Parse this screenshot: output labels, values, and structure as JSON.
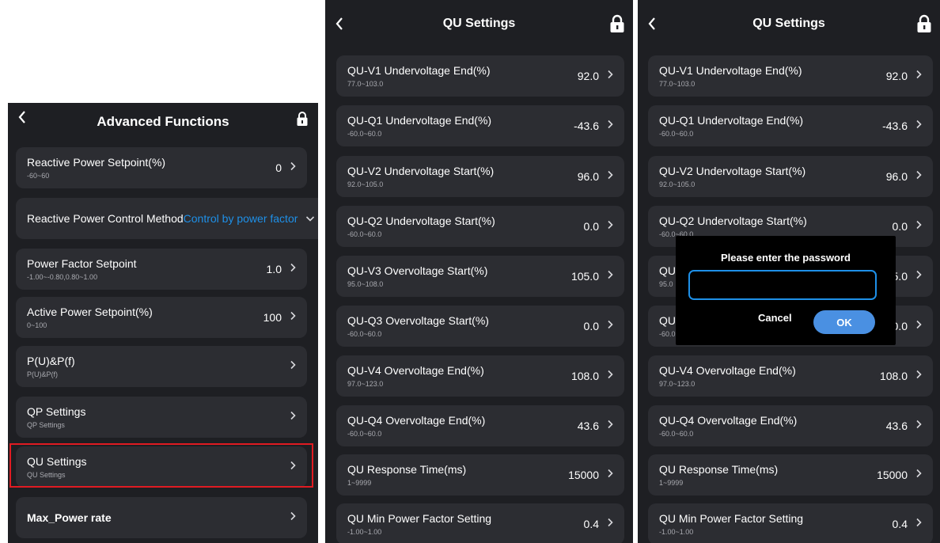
{
  "left": {
    "title": "Advanced Functions",
    "items": [
      {
        "label": "Reactive Power Setpoint(%)",
        "range": "-60~60",
        "value": "0"
      },
      {
        "label_main": "Reactive Power Control Method",
        "label_accent": "Control by power factor"
      },
      {
        "label": "Power Factor Setpoint",
        "range": "-1.00~-0.80,0.80~1.00",
        "value": "1.0"
      },
      {
        "label": "Active Power Setpoint(%)",
        "range": "0~100",
        "value": "100"
      },
      {
        "label": "P(U)&P(f)",
        "range": "P(U)&P(f)",
        "value": ""
      },
      {
        "label": "QP Settings",
        "range": "QP Settings",
        "value": ""
      },
      {
        "label": "QU Settings",
        "range": "QU Settings",
        "value": ""
      },
      {
        "label": "Max_Power rate",
        "range": "",
        "value": ""
      }
    ],
    "highlight_color": "#e01b22"
  },
  "middle": {
    "title": "QU Settings",
    "items": [
      {
        "label": "QU-V1 Undervoltage End(%)",
        "range": "77.0~103.0",
        "value": "92.0"
      },
      {
        "label": "QU-Q1 Undervoltage End(%)",
        "range": "-60.0~60.0",
        "value": "-43.6"
      },
      {
        "label": "QU-V2 Undervoltage Start(%)",
        "range": "92.0~105.0",
        "value": "96.0"
      },
      {
        "label": "QU-Q2 Undervoltage Start(%)",
        "range": "-60.0~60.0",
        "value": "0.0"
      },
      {
        "label": "QU-V3 Overvoltage Start(%)",
        "range": "95.0~108.0",
        "value": "105.0"
      },
      {
        "label": "QU-Q3 Overvoltage Start(%)",
        "range": "-60.0~60.0",
        "value": "0.0"
      },
      {
        "label": "QU-V4 Overvoltage End(%)",
        "range": "97.0~123.0",
        "value": "108.0"
      },
      {
        "label": "QU-Q4 Overvoltage End(%)",
        "range": "-60.0~60.0",
        "value": "43.6"
      },
      {
        "label": "QU Response Time(ms)",
        "range": "1~9999",
        "value": "15000"
      },
      {
        "label": "QU Min Power Factor Setting",
        "range": "-1.00~1.00",
        "value": "0.4"
      }
    ]
  },
  "right": {
    "title": "QU Settings",
    "items": [
      {
        "label": "QU-V1 Undervoltage End(%)",
        "range": "77.0~103.0",
        "value": "92.0"
      },
      {
        "label": "QU-Q1 Undervoltage End(%)",
        "range": "-60.0~60.0",
        "value": "-43.6"
      },
      {
        "label": "QU-V2 Undervoltage Start(%)",
        "range": "92.0~105.0",
        "value": "96.0"
      },
      {
        "label": "QU-Q2 Undervoltage Start(%)",
        "range": "-60.0~60.0",
        "value": "0.0"
      },
      {
        "label": "QU-",
        "range": "95.0",
        "value": "05.0"
      },
      {
        "label": "QU-",
        "range": "-60.0",
        "value": "0.0"
      },
      {
        "label": "QU-V4 Overvoltage End(%)",
        "range": "97.0~123.0",
        "value": "108.0"
      },
      {
        "label": "QU-Q4 Overvoltage End(%)",
        "range": "-60.0~60.0",
        "value": "43.6"
      },
      {
        "label": "QU Response Time(ms)",
        "range": "1~9999",
        "value": "15000"
      },
      {
        "label": "QU Min Power Factor Setting",
        "range": "-1.00~1.00",
        "value": "0.4"
      }
    ],
    "dialog": {
      "title": "Please enter the password",
      "password_value": "",
      "cancel_label": "Cancel",
      "ok_label": "OK"
    }
  },
  "colors": {
    "background": "#1e1f23",
    "card": "#2c2d32",
    "accent": "#1e90e8",
    "ok_button": "#4a90e2"
  },
  "icons": [
    "back-icon",
    "lock-icon",
    "chevron-right-icon",
    "chevron-down-icon"
  ]
}
